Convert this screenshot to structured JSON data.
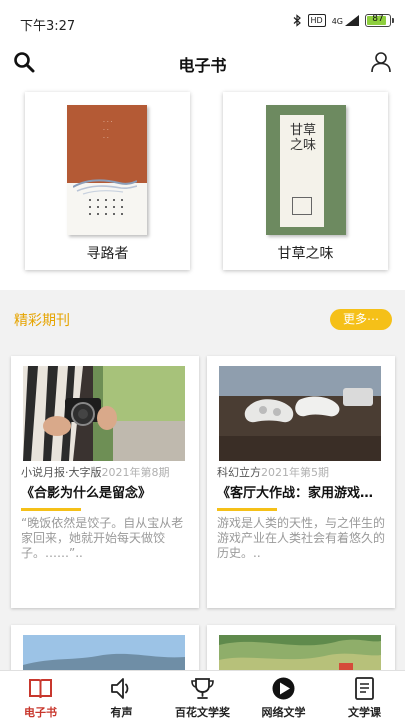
{
  "status_bar": {
    "time": "下午3:27",
    "bluetooth_icon": "bluetooth-icon",
    "hd_label": "HD",
    "network_label": "4G",
    "battery_level": "87",
    "battery_fraction": 0.87
  },
  "header": {
    "title": "电子书",
    "search_icon": "search-icon",
    "user_icon": "user-icon"
  },
  "books": [
    {
      "title": "寻路者"
    },
    {
      "title": "甘草之味",
      "cover_text": "甘草之味"
    }
  ],
  "periodicals": {
    "section_title": "精彩期刊",
    "more_label": "更多⋯",
    "items": [
      {
        "magazine": "小说月报·大字版",
        "issue": "2021年第8期",
        "title": "《合影为什么是留念》",
        "description": "“晚饭依然是饺子。自从宝从老家回来，她就开始每天做饺子。……”.."
      },
      {
        "magazine": "科幻立方",
        "issue": "2021年第5期",
        "title": "《客厅大作战：家用游戏机的过去》",
        "description": "游戏是人类的天性，与之伴生的游戏产业在人类社会有着悠久的历史。.."
      }
    ]
  },
  "tabs": [
    {
      "label": "电子书",
      "icon": "book-icon",
      "active": true
    },
    {
      "label": "有声",
      "icon": "speaker-icon",
      "active": false
    },
    {
      "label": "百花文学奖",
      "icon": "trophy-icon",
      "active": false
    },
    {
      "label": "网络文学",
      "icon": "play-circle-icon",
      "active": false
    },
    {
      "label": "文学课",
      "icon": "notebook-icon",
      "active": false
    }
  ],
  "colors": {
    "accent": "#f5c018",
    "section_title": "#e6a400",
    "active_tab": "#c8372d",
    "battery": "#8ecf3e"
  }
}
